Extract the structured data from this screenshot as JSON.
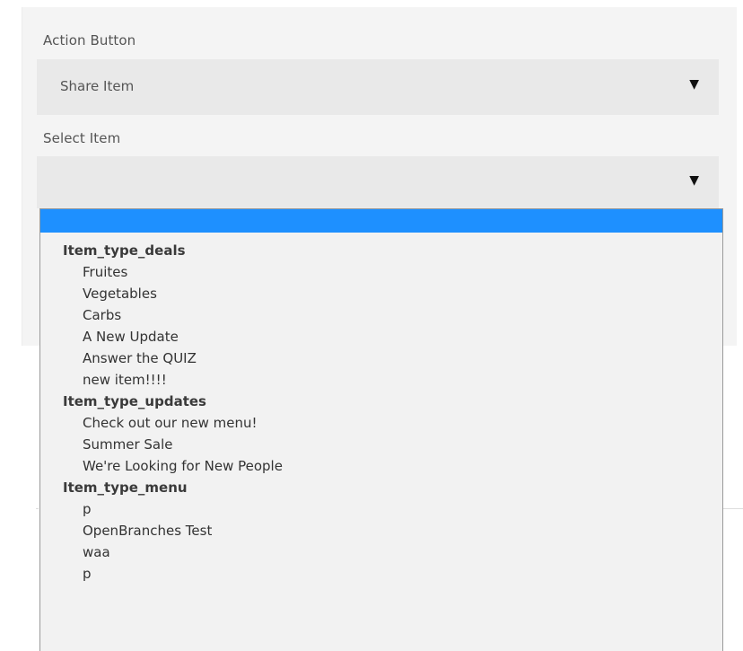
{
  "action_button": {
    "label": "Action Button",
    "selected_value": "Share Item",
    "caret": "▼"
  },
  "select_item": {
    "label": "Select Item",
    "selected_value": "",
    "caret": "▼"
  },
  "dropdown": {
    "highlight_color": "#1e90ff",
    "groups": [
      {
        "label": "Item_type_deals",
        "options": [
          "Fruites",
          "Vegetables",
          "Carbs",
          "A New Update",
          "Answer the QUIZ",
          "new item!!!!"
        ]
      },
      {
        "label": "Item_type_updates",
        "options": [
          "Check out our new menu!",
          "Summer Sale",
          "We're Looking for New People"
        ]
      },
      {
        "label": "Item_type_menu",
        "options": [
          "p",
          "OpenBranches Test",
          "waa",
          "p"
        ]
      }
    ]
  }
}
